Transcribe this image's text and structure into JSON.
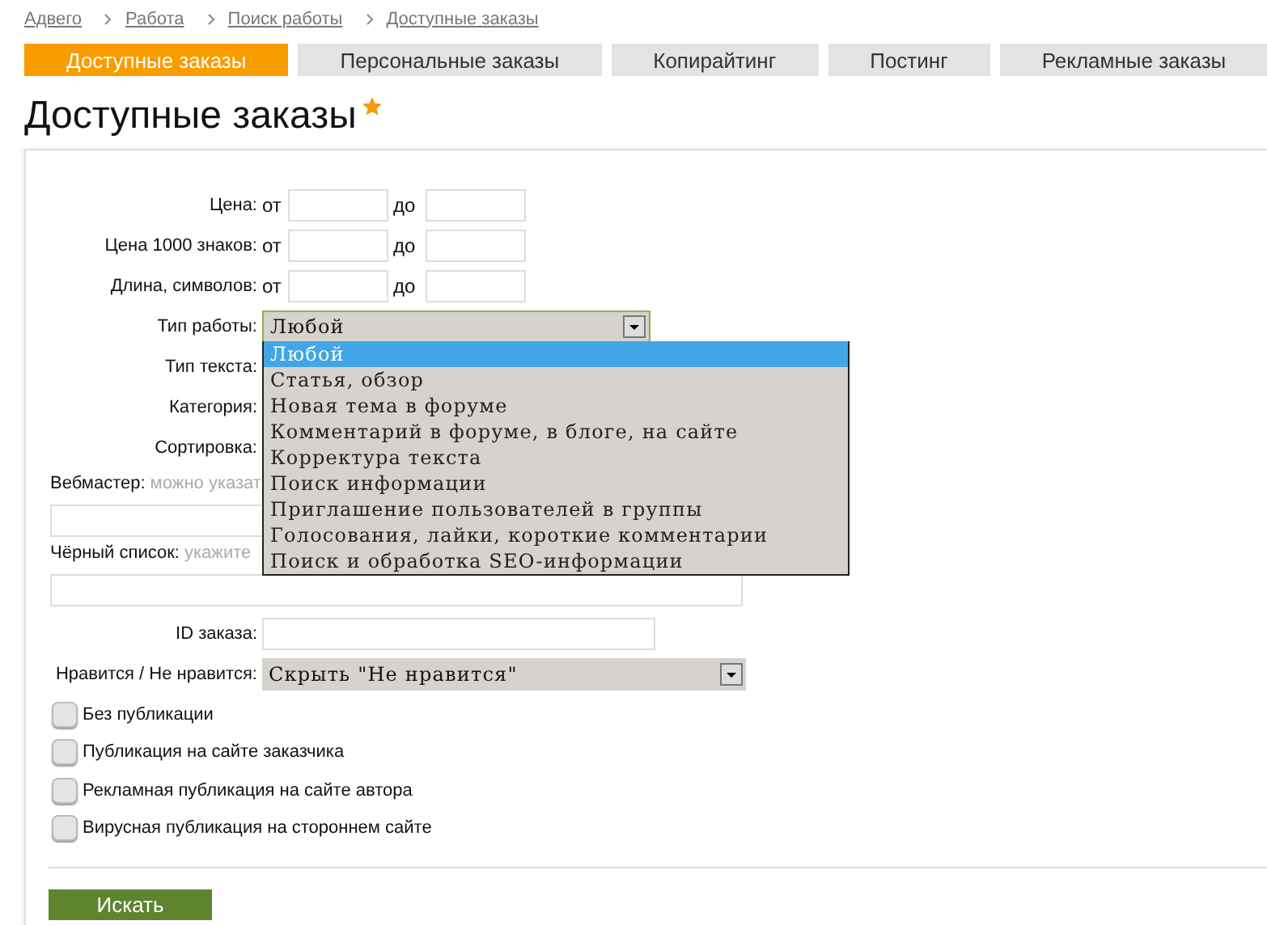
{
  "breadcrumbs": [
    "Адвего",
    "Работа",
    "Поиск работы",
    "Доступные заказы"
  ],
  "tabs": [
    {
      "label": "Доступные заказы",
      "selected": true
    },
    {
      "label": "Персональные заказы",
      "selected": false
    },
    {
      "label": "Копирайтинг",
      "selected": false
    },
    {
      "label": "Постинг",
      "selected": false
    },
    {
      "label": "Рекламные заказы",
      "selected": false
    }
  ],
  "title": "Доступные заказы",
  "form": {
    "ranges": [
      {
        "label": "Цена:",
        "from": "от",
        "to": "до"
      },
      {
        "label": "Цена 1000 знаков:",
        "from": "от",
        "to": "до"
      },
      {
        "label": "Длина, символов:",
        "from": "от",
        "to": "до"
      }
    ],
    "work_type": {
      "label": "Тип работы:",
      "value": "Любой",
      "expanded": true,
      "options": [
        {
          "label": "Любой",
          "selected": true
        },
        {
          "label": "Статья, обзор",
          "selected": false
        },
        {
          "label": "Новая тема в форуме",
          "selected": false
        },
        {
          "label": "Комментарий в форуме, в блоге, на сайте",
          "selected": false
        },
        {
          "label": "Корректура текста",
          "selected": false
        },
        {
          "label": "Поиск информации",
          "selected": false
        },
        {
          "label": "Приглашение пользователей в группы",
          "selected": false
        },
        {
          "label": "Голосования, лайки, короткие комментарии",
          "selected": false
        },
        {
          "label": "Поиск и обработка SEO-информации",
          "selected": false
        }
      ]
    },
    "covered_rows": [
      "Тип текста:",
      "Категория:",
      "Сортировка:"
    ],
    "webmaster": {
      "label": "Вебмастер:",
      "hint": "можно указат"
    },
    "blacklist": {
      "label": "Чёрный список:",
      "hint": "укажите"
    },
    "order_id": {
      "label": "ID заказа:"
    },
    "likes": {
      "label": "Нравится / Не нравится:",
      "value": "Скрыть \"Не нравится\""
    },
    "checkboxes": [
      {
        "label": "Без публикации",
        "checked": false
      },
      {
        "label": "Публикация на сайте заказчика",
        "checked": false
      },
      {
        "label": "Рекламная публикация на сайте автора",
        "checked": false
      },
      {
        "label": "Вирусная публикация на стороннем сайте",
        "checked": false
      }
    ],
    "submit": "Искать"
  }
}
